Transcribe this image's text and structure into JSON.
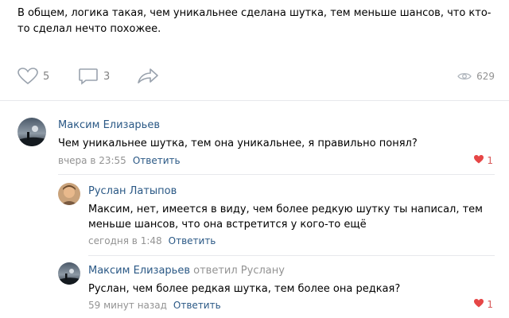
{
  "post": {
    "text": "В общем, логика такая, чем уникальнее сделана шутка, тем меньше шансов, что кто-то сделал нечто похожее.",
    "likes": "5",
    "comments": "3",
    "views": "629"
  },
  "comments": [
    {
      "author": "Максим Елизарьев",
      "text": "Чем уникальнее шутка, тем она уникальнее, я правильно понял?",
      "time": "вчера в 23:55",
      "reply_label": "Ответить",
      "likes": "1"
    },
    {
      "author": "Руслан Латыпов",
      "text": "Максим, нет, имеется в виду, чем более редкую шутку ты написал, тем меньше шансов, что она встретится у кого-то ещё",
      "time": "сегодня в 1:48",
      "reply_label": "Ответить"
    },
    {
      "author": "Максим Елизарьев",
      "replied_to": "ответил Руслану",
      "text": "Руслан, чем более редкая шутка, тем более она редкая?",
      "time": "59 минут назад",
      "reply_label": "Ответить",
      "likes": "1"
    }
  ],
  "colors": {
    "link": "#2a5885",
    "muted": "#939393",
    "like_red": "#e64646",
    "divider": "#e7e8ec"
  }
}
